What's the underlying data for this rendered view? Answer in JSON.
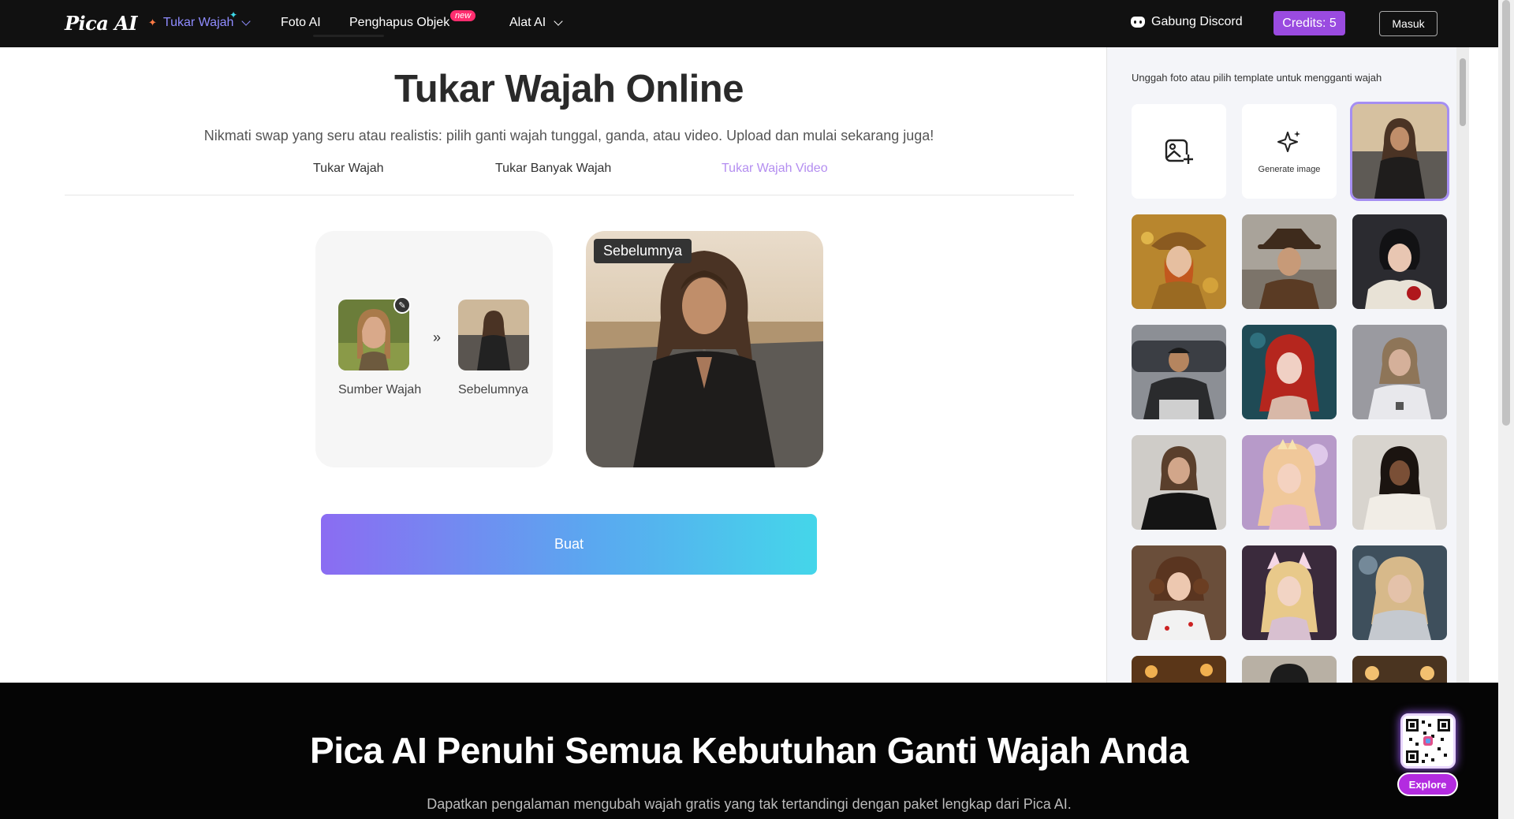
{
  "nav": {
    "logo": "Pica AI",
    "items": [
      {
        "label": "Tukar Wajah",
        "active": true
      },
      {
        "label": "Foto AI"
      },
      {
        "label": "Penghapus Objek",
        "badge": "new"
      },
      {
        "label": "Alat AI"
      }
    ],
    "discord": "Gabung Discord",
    "credits": "Credits: 5",
    "login": "Masuk"
  },
  "main": {
    "title": "Tukar Wajah Online",
    "subtitle": "Nikmati swap yang seru atau realistis: pilih ganti wajah tunggal, ganda, atau video. Upload dan mulai sekarang juga!",
    "tabs": [
      "Tukar Wajah",
      "Tukar Banyak Wajah",
      "Tukar Wajah Video"
    ],
    "source_label": "Sumber Wajah",
    "target_label": "Sebelumnya",
    "arrow": "»",
    "preview_tag": "Sebelumnya",
    "button": "Buat"
  },
  "panel": {
    "hint": "Unggah foto atau pilih template untuk mengganti wajah",
    "generate_label": "Generate image"
  },
  "footer": {
    "title": "Pica AI Penuhi Semua Kebutuhan Ganti Wajah Anda",
    "subtitle": "Dapatkan pengalaman mengubah wajah gratis yang tak tertandingi dengan paket lengkap dari Pica AI.",
    "explore": "Explore"
  },
  "colors": {
    "accent": "#9a4be0",
    "nav_bg": "#111111",
    "active_nav": "#8f8cff"
  }
}
